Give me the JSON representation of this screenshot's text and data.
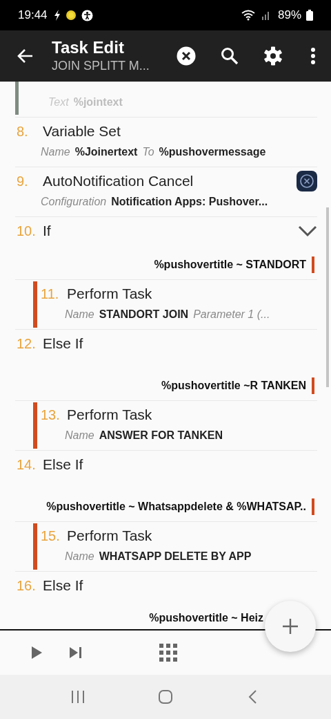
{
  "status_bar": {
    "time": "19:44",
    "battery": "89%"
  },
  "app_bar": {
    "title": "Task Edit",
    "subtitle": "JOIN SPLITT M..."
  },
  "actions": [
    {
      "kind": "action",
      "disabled": true,
      "args": [
        {
          "label": "Text",
          "value": "%jointext"
        }
      ]
    },
    {
      "number": "8.",
      "title": "Variable Set",
      "kind": "action",
      "disabled": false,
      "args": [
        {
          "label": "Name",
          "value": "%Joinertext"
        },
        {
          "label": "To",
          "value": "%pushovermessage"
        }
      ]
    },
    {
      "number": "9.",
      "title": "AutoNotification Cancel",
      "kind": "plugin",
      "disabled": false,
      "args": [
        {
          "label": "Configuration",
          "value": "Notification Apps: Pushover..."
        }
      ]
    },
    {
      "number": "10.",
      "title": "If",
      "kind": "if",
      "disabled": false,
      "condition": "%pushovertitle ~ STANDORT",
      "children": [
        {
          "number": "11.",
          "title": "Perform Task",
          "kind": "action",
          "disabled": false,
          "args": [
            {
              "label": "Name",
              "value": "STANDORT JOIN"
            },
            {
              "label": "Parameter 1 (..."
            }
          ]
        }
      ]
    },
    {
      "number": "12.",
      "title": "Else If",
      "kind": "else_if",
      "disabled": false,
      "condition": "%pushovertitle ~R TANKEN",
      "children": [
        {
          "number": "13.",
          "title": "Perform Task",
          "kind": "action",
          "disabled": false,
          "args": [
            {
              "label": "Name",
              "value": "ANSWER FOR TANKEN"
            }
          ]
        }
      ]
    },
    {
      "number": "14.",
      "title": "Else If",
      "kind": "else_if",
      "disabled": false,
      "condition": "%pushovertitle ~ Whatsappdelete & %WHATSAP..",
      "children": [
        {
          "number": "15.",
          "title": "Perform Task",
          "kind": "action",
          "disabled": false,
          "args": [
            {
              "label": "Name",
              "value": "WHATSAPP DELETE BY APP"
            }
          ]
        }
      ]
    },
    {
      "number": "16.",
      "title": "Else If",
      "kind": "else_if",
      "disabled": false,
      "condition": "%pushovertitle ~ Heiz"
    }
  ]
}
